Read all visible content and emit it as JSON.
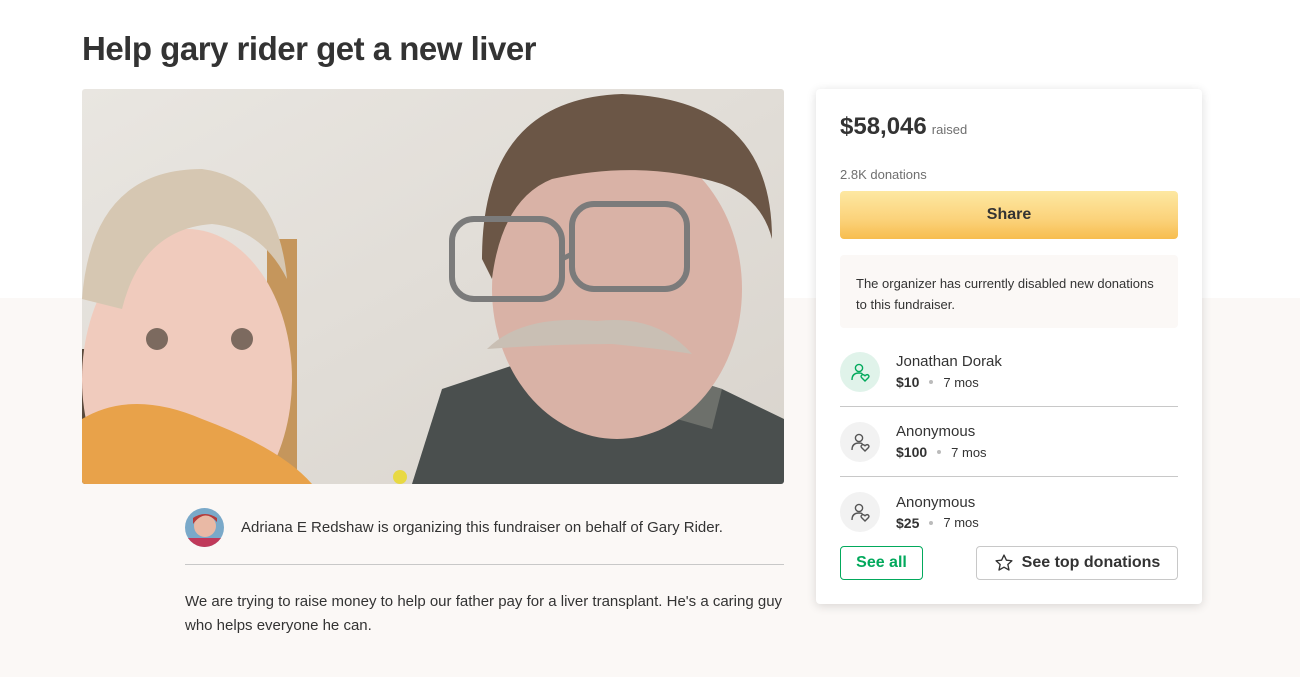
{
  "campaign": {
    "title": "Help gary rider get a new liver",
    "organizer_text": "Adriana E Redshaw is organizing this fundraiser on behalf of Gary Rider.",
    "story": "We are trying to raise money to help our father pay for a liver transplant. He's a caring guy who helps everyone he can."
  },
  "sidebar": {
    "raised_amount": "$58,046",
    "raised_label": "raised",
    "donation_count": "2.8K donations",
    "share_label": "Share",
    "notice": "The organizer has currently disabled new donations to this fundraiser.",
    "donations": [
      {
        "name": "Jonathan Dorak",
        "amount": "$10",
        "time": "7 mos"
      },
      {
        "name": "Anonymous",
        "amount": "$100",
        "time": "7 mos"
      },
      {
        "name": "Anonymous",
        "amount": "$25",
        "time": "7 mos"
      }
    ],
    "see_all_label": "See all",
    "top_donations_label": "See top donations"
  },
  "colors": {
    "accent_green": "#02a95c",
    "share_yellow": "#fbd27a",
    "page_beige": "#fbf8f6"
  },
  "icons": {
    "donor": "donor-heart-icon",
    "star": "star-icon"
  }
}
